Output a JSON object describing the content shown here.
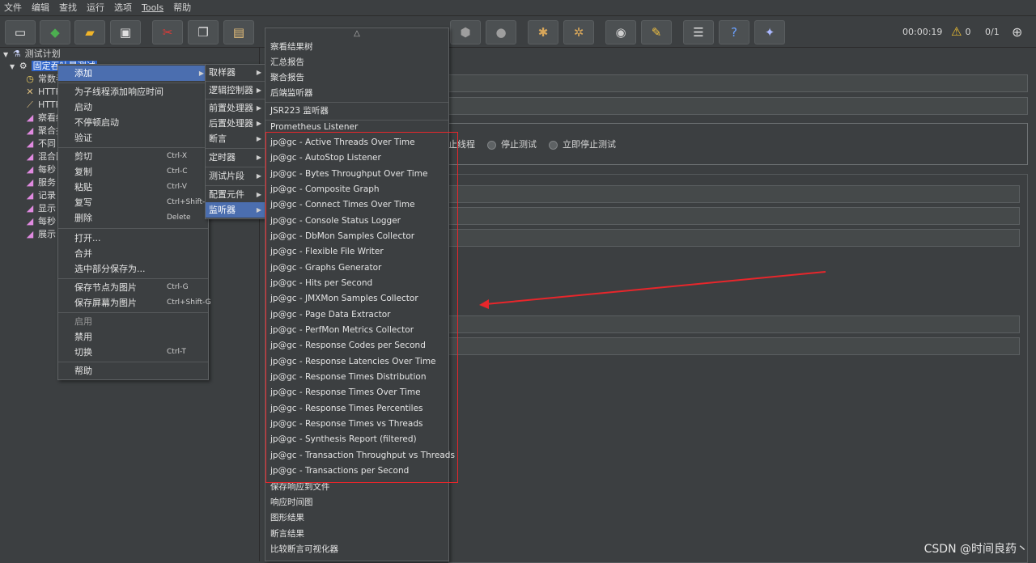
{
  "menubar": [
    "文件",
    "编辑",
    "查找",
    "运行",
    "选项",
    "Tools",
    "帮助"
  ],
  "toolbar": {
    "timer": "00:00:19",
    "warning_count": "0",
    "thread_ratio": "0/1"
  },
  "tree": {
    "root": "测试计划",
    "selected": "固定吞吐量测试",
    "children": [
      "常数吞",
      "HTTP",
      "HTTP",
      "察看结",
      "聚合报",
      "不同",
      "混合图",
      "每秒",
      "服务",
      "记录",
      "显示",
      "每秒",
      "展示"
    ]
  },
  "main": {
    "radios": [
      "止线程",
      "停止测试",
      "立即停止测试"
    ]
  },
  "menu1": {
    "items": [
      {
        "label": "添加",
        "arrow": "▶",
        "highlight": true
      },
      {
        "label": "为子线程添加响应时间"
      },
      {
        "label": "启动"
      },
      {
        "label": "不停顿启动"
      },
      {
        "label": "验证"
      },
      {
        "label": "剪切",
        "shortcut": "Ctrl-X"
      },
      {
        "label": "复制",
        "shortcut": "Ctrl-C"
      },
      {
        "label": "粘贴",
        "shortcut": "Ctrl-V"
      },
      {
        "label": "复写",
        "shortcut": "Ctrl+Shift-C"
      },
      {
        "label": "删除",
        "shortcut": "Delete"
      },
      {
        "label": "打开..."
      },
      {
        "label": "合并"
      },
      {
        "label": "选中部分保存为..."
      },
      {
        "label": "保存节点为图片",
        "shortcut": "Ctrl-G"
      },
      {
        "label": "保存屏幕为图片",
        "shortcut": "Ctrl+Shift-G"
      },
      {
        "label": "启用"
      },
      {
        "label": "禁用"
      },
      {
        "label": "切换",
        "shortcut": "Ctrl-T"
      },
      {
        "label": "帮助"
      }
    ]
  },
  "menu2": {
    "items": [
      {
        "label": "取样器",
        "arrow": "▶"
      },
      {
        "label": "逻辑控制器",
        "arrow": "▶"
      },
      {
        "label": "前置处理器",
        "arrow": "▶"
      },
      {
        "label": "后置处理器",
        "arrow": "▶"
      },
      {
        "label": "断言",
        "arrow": "▶"
      },
      {
        "label": "定时器",
        "arrow": "▶"
      },
      {
        "label": "测试片段",
        "arrow": "▶"
      },
      {
        "label": "配置元件",
        "arrow": "▶"
      },
      {
        "label": "监听器",
        "arrow": "▶",
        "highlight": true
      }
    ]
  },
  "menu3": {
    "scroll_arrow": "△",
    "items": [
      "察看结果树",
      "汇总报告",
      "聚合报告",
      "后端监听器",
      "JSR223 监听器",
      "Prometheus Listener",
      "jp@gc - Active Threads Over Time",
      "jp@gc - AutoStop Listener",
      "jp@gc - Bytes Throughput Over Time",
      "jp@gc - Composite Graph",
      "jp@gc - Connect Times Over Time",
      "jp@gc - Console Status Logger",
      "jp@gc - DbMon Samples Collector",
      "jp@gc - Flexible File Writer",
      "jp@gc - Graphs Generator",
      "jp@gc - Hits per Second",
      "jp@gc - JMXMon Samples Collector",
      "jp@gc - Page Data Extractor",
      "jp@gc - PerfMon Metrics Collector",
      "jp@gc - Response Codes per Second",
      "jp@gc - Response Latencies Over Time",
      "jp@gc - Response Times Distribution",
      "jp@gc - Response Times Over Time",
      "jp@gc - Response Times Percentiles",
      "jp@gc - Response Times vs Threads",
      "jp@gc - Synthesis Report (filtered)",
      "jp@gc - Transaction Throughput vs Threads",
      "jp@gc - Transactions per Second",
      "保存响应到文件",
      "响应时间图",
      "图形结果",
      "断言结果",
      "比较断言可视化器"
    ]
  },
  "colors": {
    "highlight_box": "#e8262b",
    "menu_highlight": "#4b6eaf"
  },
  "watermark": "CSDN @时间良药丶"
}
